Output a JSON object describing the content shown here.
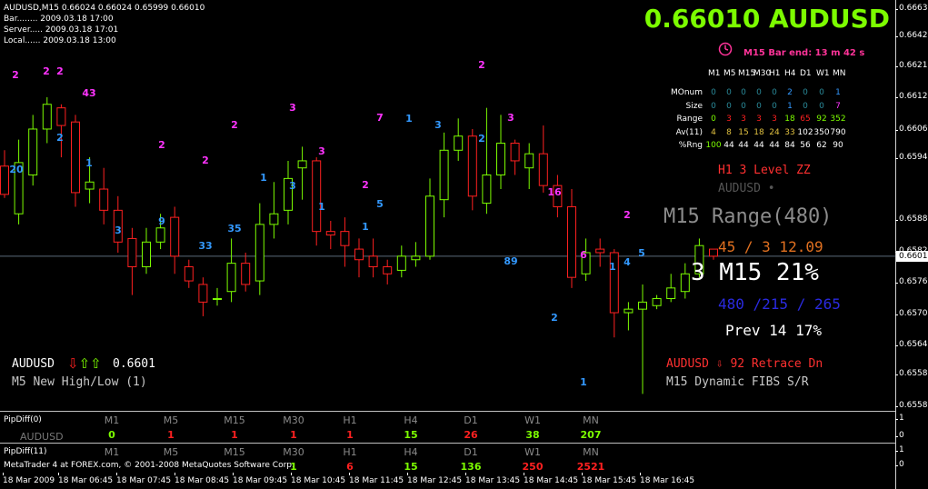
{
  "header": {
    "symbol_line": "AUDUSD,M15  0.66024 0.66024 0.65999 0.66010",
    "bar_line": "Bar........ 2009.03.18 17:00",
    "server_line": "Server..... 2009.03.18 17:01",
    "local_line": "Local...... 2009.03.18 13:00"
  },
  "big_price": "0.66010 AUDUSD",
  "bar_end": "M15 Bar end: 13 m 42 s",
  "colors": {
    "bull": "#7cfc00",
    "bear": "#ff2020",
    "magenta": "#ff33ff",
    "blue": "#3399ff",
    "background": "#000000"
  },
  "stats": {
    "headers": [
      "M1",
      "M5",
      "M15",
      "M30",
      "H1",
      "H4",
      "D1",
      "W1",
      "MN"
    ],
    "rows": [
      {
        "label": "MOnum",
        "values": [
          "0",
          "0",
          "0",
          "0",
          "0",
          "2",
          "0",
          "0",
          "1"
        ]
      },
      {
        "label": "Size",
        "values": [
          "0",
          "0",
          "0",
          "0",
          "0",
          "1",
          "0",
          "0",
          "7"
        ]
      },
      {
        "label": "Range",
        "values": [
          "0",
          "3",
          "3",
          "3",
          "3",
          "18",
          "65",
          "92",
          "352"
        ]
      },
      {
        "label": "Av(11)",
        "values": [
          "4",
          "8",
          "15",
          "18",
          "24",
          "33",
          "102",
          "350",
          "790"
        ]
      },
      {
        "label": "%Rng",
        "values": [
          "100",
          "44",
          "44",
          "44",
          "44",
          "84",
          "56",
          "62",
          "90"
        ]
      }
    ]
  },
  "right_panel": {
    "h1_level": "H1 3 Level ZZ",
    "symbol_dim": "AUDUSD •",
    "range": "M15 Range(480)",
    "range_sub": "45 / 3    12.09",
    "m15_pct": "3  M15 21%",
    "ratio": "480 /215 / 265",
    "prev": "Prev 14   17%",
    "retrace": "AUDUSD ⇩ 92 Retrace Dn",
    "fibs": "M15 Dynamic FIBS S/R"
  },
  "left_panel": {
    "symbol": "AUDUSD",
    "arrows": "⇩⇧⇧",
    "price": "0.6601",
    "newhl": "M5 New High/Low (1)"
  },
  "price_scale": {
    "ticks": [
      "0.66635",
      "0.66425",
      "0.66215",
      "0.66125",
      "0.66065",
      "0.65945",
      "0.65885",
      "0.65825",
      "0.65765",
      "0.65705",
      "0.65645",
      "0.65585"
    ],
    "current": "0.66010",
    "sub_ticks": [
      "1",
      "0",
      "1",
      "0"
    ]
  },
  "subpanel1": {
    "label": "PipDiff(0)",
    "symbol": "AUDUSD",
    "timeframes": [
      "M1",
      "M5",
      "M15",
      "M30",
      "H1",
      "H4",
      "D1",
      "W1",
      "MN"
    ],
    "values": [
      "0",
      "1",
      "1",
      "1",
      "1",
      "15",
      "26",
      "38",
      "207"
    ],
    "value_colors": [
      "#7cfc00",
      "#ff2020",
      "#ff2020",
      "#ff2020",
      "#ff2020",
      "#7cfc00",
      "#ff2020",
      "#7cfc00",
      "#7cfc00"
    ]
  },
  "subpanel2": {
    "label": "PipDiff(11)",
    "timeframes": [
      "M1",
      "M5",
      "M15",
      "M30",
      "H1",
      "H4",
      "D1",
      "W1",
      "MN"
    ],
    "values": [
      "",
      "",
      "",
      "1",
      "6",
      "15",
      "136",
      "250",
      "2521"
    ],
    "value_colors": [
      "#7cfc00",
      "#7cfc00",
      "#7cfc00",
      "#7cfc00",
      "#ff2020",
      "#7cfc00",
      "#7cfc00",
      "#ff2020",
      "#ff2020"
    ],
    "copyright": "MetaTrader 4 at FOREX.com, © 2001-2008 MetaQuotes Software Corp."
  },
  "time_axis": [
    "18 Mar 2009",
    "18 Mar 06:45",
    "18 Mar 07:45",
    "18 Mar 08:45",
    "18 Mar 09:45",
    "18 Mar 10:45",
    "18 Mar 11:45",
    "18 Mar 12:45",
    "18 Mar 13:45",
    "18 Mar 14:45",
    "18 Mar 15:45",
    "18 Mar 16:45"
  ],
  "markers": [
    {
      "t": "2",
      "c": "magenta"
    },
    {
      "t": "20",
      "c": "blue"
    },
    {
      "t": "2",
      "c": "magenta"
    },
    {
      "t": "2",
      "c": "magenta"
    },
    {
      "t": "2",
      "c": "blue"
    },
    {
      "t": "43",
      "c": "magenta"
    },
    {
      "t": "1",
      "c": "blue"
    },
    {
      "t": "3",
      "c": "blue"
    },
    {
      "t": "2",
      "c": "magenta"
    },
    {
      "t": "9",
      "c": "blue"
    },
    {
      "t": "2",
      "c": "magenta"
    },
    {
      "t": "33",
      "c": "blue"
    },
    {
      "t": "2",
      "c": "magenta"
    },
    {
      "t": "35",
      "c": "blue"
    },
    {
      "t": "1",
      "c": "blue"
    },
    {
      "t": "3",
      "c": "magenta"
    },
    {
      "t": "3",
      "c": "blue"
    },
    {
      "t": "3",
      "c": "magenta"
    },
    {
      "t": "1",
      "c": "blue"
    },
    {
      "t": "2",
      "c": "magenta"
    },
    {
      "t": "1",
      "c": "blue"
    },
    {
      "t": "5",
      "c": "blue"
    },
    {
      "t": "7",
      "c": "magenta"
    },
    {
      "t": "1",
      "c": "blue"
    },
    {
      "t": "3",
      "c": "blue"
    },
    {
      "t": "2",
      "c": "magenta"
    },
    {
      "t": "2",
      "c": "blue"
    },
    {
      "t": "3",
      "c": "magenta"
    },
    {
      "t": "89",
      "c": "blue"
    },
    {
      "t": "16",
      "c": "magenta"
    },
    {
      "t": "2",
      "c": "blue"
    },
    {
      "t": "6",
      "c": "magenta"
    },
    {
      "t": "1",
      "c": "blue"
    },
    {
      "t": "1",
      "c": "blue"
    },
    {
      "t": "4",
      "c": "blue"
    },
    {
      "t": "2",
      "c": "magenta"
    },
    {
      "t": "5",
      "c": "blue"
    }
  ],
  "candles": [
    [
      0.66265,
      0.66185,
      0.6631,
      0.66175
    ],
    [
      0.6613,
      0.66275,
      0.6634,
      0.661
    ],
    [
      0.6624,
      0.6637,
      0.6641,
      0.6621
    ],
    [
      0.6637,
      0.6644,
      0.6646,
      0.6633
    ],
    [
      0.6643,
      0.6638,
      0.6644,
      0.6629
    ],
    [
      0.6639,
      0.6619,
      0.6641,
      0.6615
    ],
    [
      0.662,
      0.6622,
      0.6629,
      0.6616
    ],
    [
      0.662,
      0.6614,
      0.6626,
      0.661
    ],
    [
      0.6614,
      0.6605,
      0.6618,
      0.6602
    ],
    [
      0.6606,
      0.6598,
      0.6609,
      0.659
    ],
    [
      0.6598,
      0.6605,
      0.6609,
      0.6596
    ],
    [
      0.6605,
      0.6609,
      0.6613,
      0.6603
    ],
    [
      0.6612,
      0.6601,
      0.6615,
      0.6596
    ],
    [
      0.6598,
      0.6594,
      0.66,
      0.6592
    ],
    [
      0.6593,
      0.6588,
      0.6595,
      0.6584
    ],
    [
      0.6589,
      0.6589,
      0.6592,
      0.6587
    ],
    [
      0.6591,
      0.6599,
      0.6606,
      0.6588
    ],
    [
      0.6599,
      0.6593,
      0.6602,
      0.6591
    ],
    [
      0.6594,
      0.661,
      0.6616,
      0.659
    ],
    [
      0.661,
      0.6613,
      0.6622,
      0.6606
    ],
    [
      0.6614,
      0.6623,
      0.6628,
      0.661
    ],
    [
      0.6626,
      0.6628,
      0.6632,
      0.6617
    ],
    [
      0.6628,
      0.6608,
      0.6629,
      0.6604
    ],
    [
      0.6608,
      0.6607,
      0.6611,
      0.6603
    ],
    [
      0.6608,
      0.6604,
      0.6612,
      0.6598
    ],
    [
      0.6603,
      0.66,
      0.6606,
      0.6595
    ],
    [
      0.6601,
      0.6598,
      0.6606,
      0.6595
    ],
    [
      0.6598,
      0.6596,
      0.66,
      0.6593
    ],
    [
      0.6597,
      0.6601,
      0.6604,
      0.6595
    ],
    [
      0.66,
      0.6601,
      0.6605,
      0.6598
    ],
    [
      0.6601,
      0.6618,
      0.6623,
      0.66
    ],
    [
      0.6617,
      0.6631,
      0.6636,
      0.6612
    ],
    [
      0.6631,
      0.6635,
      0.664,
      0.6628
    ],
    [
      0.6635,
      0.6618,
      0.6637,
      0.6614
    ],
    [
      0.6616,
      0.6624,
      0.6643,
      0.6613
    ],
    [
      0.6624,
      0.6633,
      0.6641,
      0.662
    ],
    [
      0.6633,
      0.6628,
      0.6634,
      0.6624
    ],
    [
      0.6626,
      0.663,
      0.6633,
      0.662
    ],
    [
      0.663,
      0.6621,
      0.6638,
      0.6619
    ],
    [
      0.6621,
      0.6615,
      0.6624,
      0.6612
    ],
    [
      0.6615,
      0.6595,
      0.662,
      0.6592
    ],
    [
      0.6596,
      0.6602,
      0.6606,
      0.6594
    ],
    [
      0.6603,
      0.6602,
      0.6606,
      0.6598
    ],
    [
      0.6602,
      0.6585,
      0.6603,
      0.6578
    ],
    [
      0.6585,
      0.6586,
      0.6588,
      0.658
    ],
    [
      0.6586,
      0.6588,
      0.6593,
      0.6562
    ],
    [
      0.6587,
      0.6589,
      0.659,
      0.6586
    ],
    [
      0.6589,
      0.6592,
      0.6596,
      0.6588
    ],
    [
      0.6591,
      0.6596,
      0.6599,
      0.6589
    ],
    [
      0.6596,
      0.6604,
      0.6606,
      0.6595
    ],
    [
      0.6603,
      0.6601,
      0.6603,
      0.66
    ]
  ]
}
